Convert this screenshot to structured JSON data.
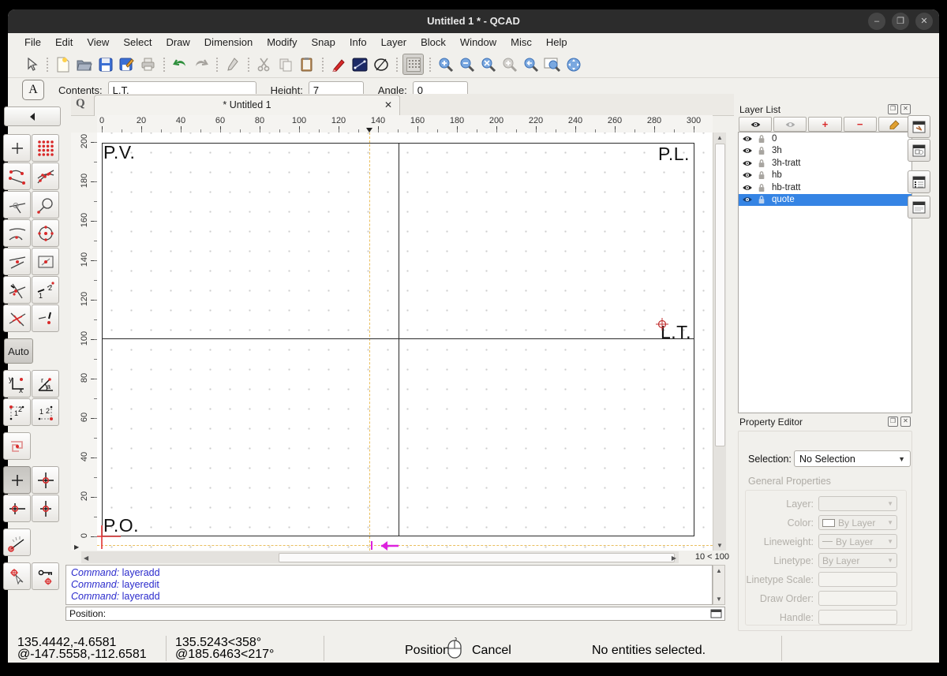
{
  "window": {
    "title": "Untitled 1 * - QCAD"
  },
  "menu_items": [
    "File",
    "Edit",
    "View",
    "Select",
    "Draw",
    "Dimension",
    "Modify",
    "Snap",
    "Info",
    "Layer",
    "Block",
    "Window",
    "Misc",
    "Help"
  ],
  "toolbar": {
    "icons": [
      "select-arrow",
      "new-file",
      "open-file",
      "save",
      "save-as",
      "print",
      "undo",
      "redo",
      "pen",
      "cut",
      "copy",
      "paste",
      "draw-text",
      "line-tool",
      "ellipse-tool",
      "grid-toggle",
      "zoom-in",
      "zoom-out",
      "auto-zoom",
      "zoom-actual",
      "previous-view",
      "zoom-window",
      "pan"
    ]
  },
  "options_toolbar": {
    "tool_button": "A",
    "contents_label": "Contents:",
    "contents_value": "L.T.",
    "height_label": "Height:",
    "height_value": "7",
    "angle_label": "Angle:",
    "angle_value": "0"
  },
  "snap_toolbar": {
    "auto_label": "Auto",
    "icons": [
      "back",
      "snap-free",
      "snap-grid",
      "snap-endpoints",
      "snap-on-entity",
      "snap-perpendicular",
      "snap-tangential",
      "snap-middle-manual",
      "snap-center",
      "snap-middle",
      "snap-reference",
      "snap-intersection-auto",
      "snap-intersection-manual",
      "snap-intersection",
      "snap-off",
      "coordinate-cartesian",
      "coordinate-polar",
      "distance-manual-1",
      "distance-manual-2",
      "snap-polyline",
      "restrict-off",
      "restrict-orthogonal",
      "restrict-horizontal",
      "restrict-vertical",
      "restrict-angle",
      "set-relative-zero",
      "lock-relative-zero"
    ]
  },
  "tab": {
    "logo": "Q",
    "label": "* Untitled 1",
    "close": "✕"
  },
  "ruler": {
    "h_ticks": [
      "0",
      "20",
      "40",
      "60",
      "80",
      "100",
      "120",
      "140",
      "160",
      "180",
      "200",
      "220",
      "240",
      "260",
      "280",
      "300"
    ],
    "v_ticks": [
      "200",
      "180",
      "160",
      "140",
      "120",
      "100",
      "80",
      "60",
      "40",
      "20",
      "0"
    ]
  },
  "canvas": {
    "labels": {
      "top_left": "P.V.",
      "top_right": "P.L.",
      "middle_right": "L.T.",
      "bottom_left": "P.O."
    }
  },
  "scroll": {
    "grid_info": "10 < 100"
  },
  "layer_list": {
    "title": "Layer List",
    "layers": [
      {
        "name": "0"
      },
      {
        "name": "3h"
      },
      {
        "name": "3h-tratt"
      },
      {
        "name": "hb"
      },
      {
        "name": "hb-tratt"
      },
      {
        "name": "quote"
      }
    ]
  },
  "property_editor": {
    "title": "Property Editor",
    "selection_label": "Selection:",
    "selection_value": "No Selection",
    "section_label": "General Properties",
    "layer_label": "Layer:",
    "color_label": "Color:",
    "color_value": "By Layer",
    "lineweight_label": "Lineweight:",
    "lineweight_value": "By Layer",
    "linetype_label": "Linetype:",
    "linetype_value": "By Layer",
    "linetype_scale_label": "Linetype Scale:",
    "draw_order_label": "Draw Order:",
    "handle_label": "Handle:"
  },
  "command_line": {
    "history": [
      {
        "prefix": "Command:",
        "command": "layeradd"
      },
      {
        "prefix": "Command:",
        "command": "layeredit"
      },
      {
        "prefix": "Command:",
        "command": "layeradd"
      }
    ],
    "prompt_label": "Position:"
  },
  "status_bar": {
    "abs_cartesian": "135.4442,-4.6581",
    "rel_cartesian": "@-147.5558,-112.6581",
    "abs_polar": "135.5243<358°",
    "rel_polar": "@185.6463<217°",
    "mouse_left_label": "Position",
    "mouse_right_label": "Cancel",
    "selection_status": "No entities selected."
  },
  "colors": {
    "selection_blue": "#3584e4",
    "command_blue": "#2a2acc",
    "accent_red": "#cc2222",
    "construction_yellow": "#eabf5e",
    "magenta": "#dd22dd",
    "titlebar": "#2c2c2c"
  }
}
